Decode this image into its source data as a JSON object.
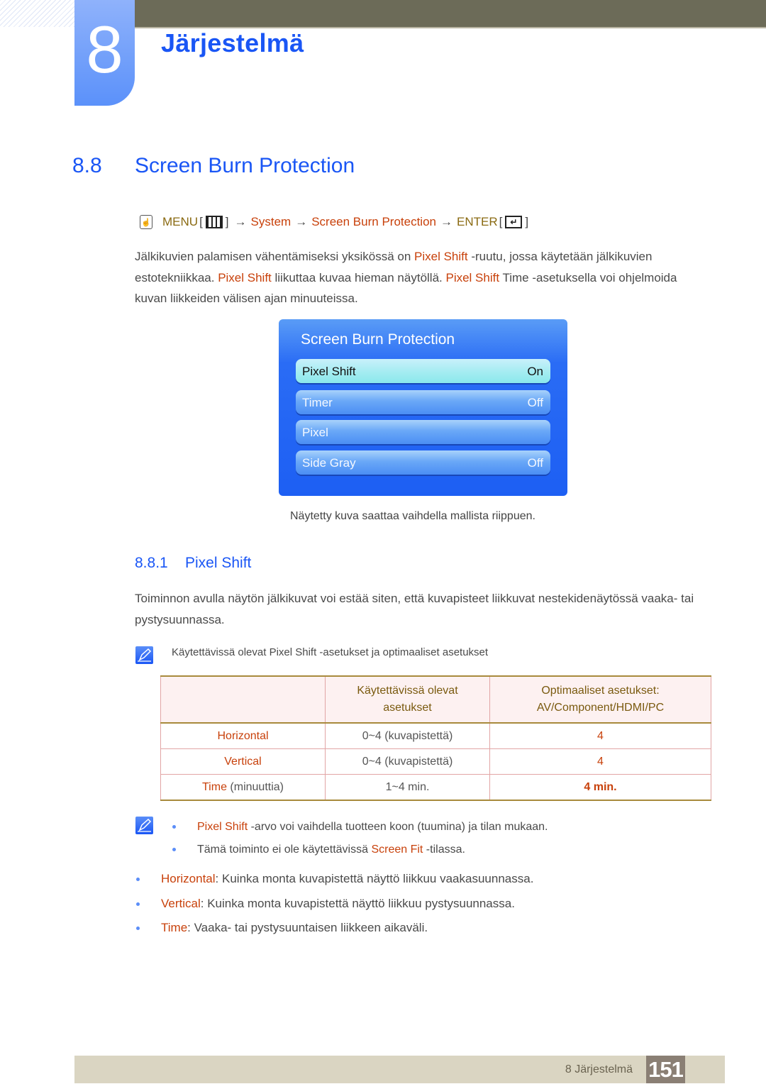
{
  "chapter": {
    "number": "8",
    "title": "Järjestelmä"
  },
  "section": {
    "number": "8.8",
    "title": "Screen Burn Protection"
  },
  "menu_path": {
    "menu": "MENU",
    "menu_icon": "menu-grid-icon",
    "arrow": "→",
    "system": "System",
    "item": "Screen Burn Protection",
    "enter": "ENTER",
    "enter_icon": "enter-icon",
    "open_bracket": "[",
    "close_bracket": "]",
    "remote_icon": "remote-hand-icon"
  },
  "intro": {
    "line1_a": "Jälkikuvien palamisen vähentämiseksi yksikössä on ",
    "line1_hl": "Pixel Shift",
    "line1_b": " -ruutu, jossa käytetään jälkikuvien",
    "line2_a": "estotekniikkaa. ",
    "line2_hl1": "Pixel Shift",
    "line2_b": " liikuttaa kuvaa hieman näytöllä. ",
    "line2_hl2": "Pixel Shift",
    "line2_c": " Time -asetuksella voi ohjelmoida",
    "line3": "kuvan liikkeiden välisen ajan minuuteissa."
  },
  "osd": {
    "title": "Screen Burn Protection",
    "items": [
      {
        "label": "Pixel Shift",
        "value": "On",
        "selected": true
      },
      {
        "label": "Timer",
        "value": "Off",
        "selected": false
      },
      {
        "label": "Pixel",
        "value": "",
        "selected": false
      },
      {
        "label": "Side Gray",
        "value": "Off",
        "selected": false
      }
    ],
    "caption": "Näytetty kuva saattaa vaihdella mallista riippuen."
  },
  "subsection": {
    "number": "8.8.1",
    "title": "Pixel Shift",
    "para_line1": "Toiminnon avulla näytön jälkikuvat voi estää siten, että kuvapisteet liikkuvat nestekidenäytössä vaaka- tai",
    "para_line2": "pystysuunnassa.",
    "note1": "Käytettävissä olevat Pixel Shift -asetukset ja optimaaliset asetukset"
  },
  "table": {
    "headers": [
      "",
      "Käytettävissä olevat\nasetukset",
      "Optimaaliset asetukset:\nAV/Component/HDMI/PC"
    ],
    "header_col2_line1": "Käytettävissä olevat",
    "header_col2_line2": "asetukset",
    "header_col3_line1": "Optimaaliset asetukset:",
    "header_col3_line2": "AV/Component/HDMI/PC",
    "rows": [
      {
        "name": "Horizontal",
        "suffix": "",
        "range": "0~4 (kuvapistettä)",
        "optimal": "4"
      },
      {
        "name": "Vertical",
        "suffix": "",
        "range": "0~4 (kuvapistettä)",
        "optimal": "4"
      },
      {
        "name": "Time",
        "suffix": " (minuuttia)",
        "range": "1~4 min.",
        "optimal": "4 min."
      }
    ]
  },
  "notes2": {
    "item1_hl": "Pixel Shift",
    "item1_text": " -arvo voi vaihdella tuotteen koon (tuumina) ja tilan mukaan.",
    "item2_a": "Tämä toiminto ei ole käytettävissä ",
    "item2_hl": "Screen Fit",
    "item2_b": " -tilassa."
  },
  "definitions": [
    {
      "term": "Horizontal",
      "text": ": Kuinka monta kuvapistettä näyttö liikkuu vaakasuunnassa."
    },
    {
      "term": "Vertical",
      "text": ": Kuinka monta kuvapistettä näyttö liikkuu pystysuunnassa."
    },
    {
      "term": "Time",
      "text": ": Vaaka- tai pystysuuntaisen liikkeen aikaväli."
    }
  ],
  "footer": {
    "label": "8 Järjestelmä",
    "page": "151"
  },
  "colors": {
    "heading_blue": "#1a56f5",
    "highlight_red": "#c8410b",
    "menu_gold": "#8a6a12",
    "top_bar": "#6c6b58",
    "footer_bar": "#dad5c2",
    "page_box": "#8a7f74"
  }
}
